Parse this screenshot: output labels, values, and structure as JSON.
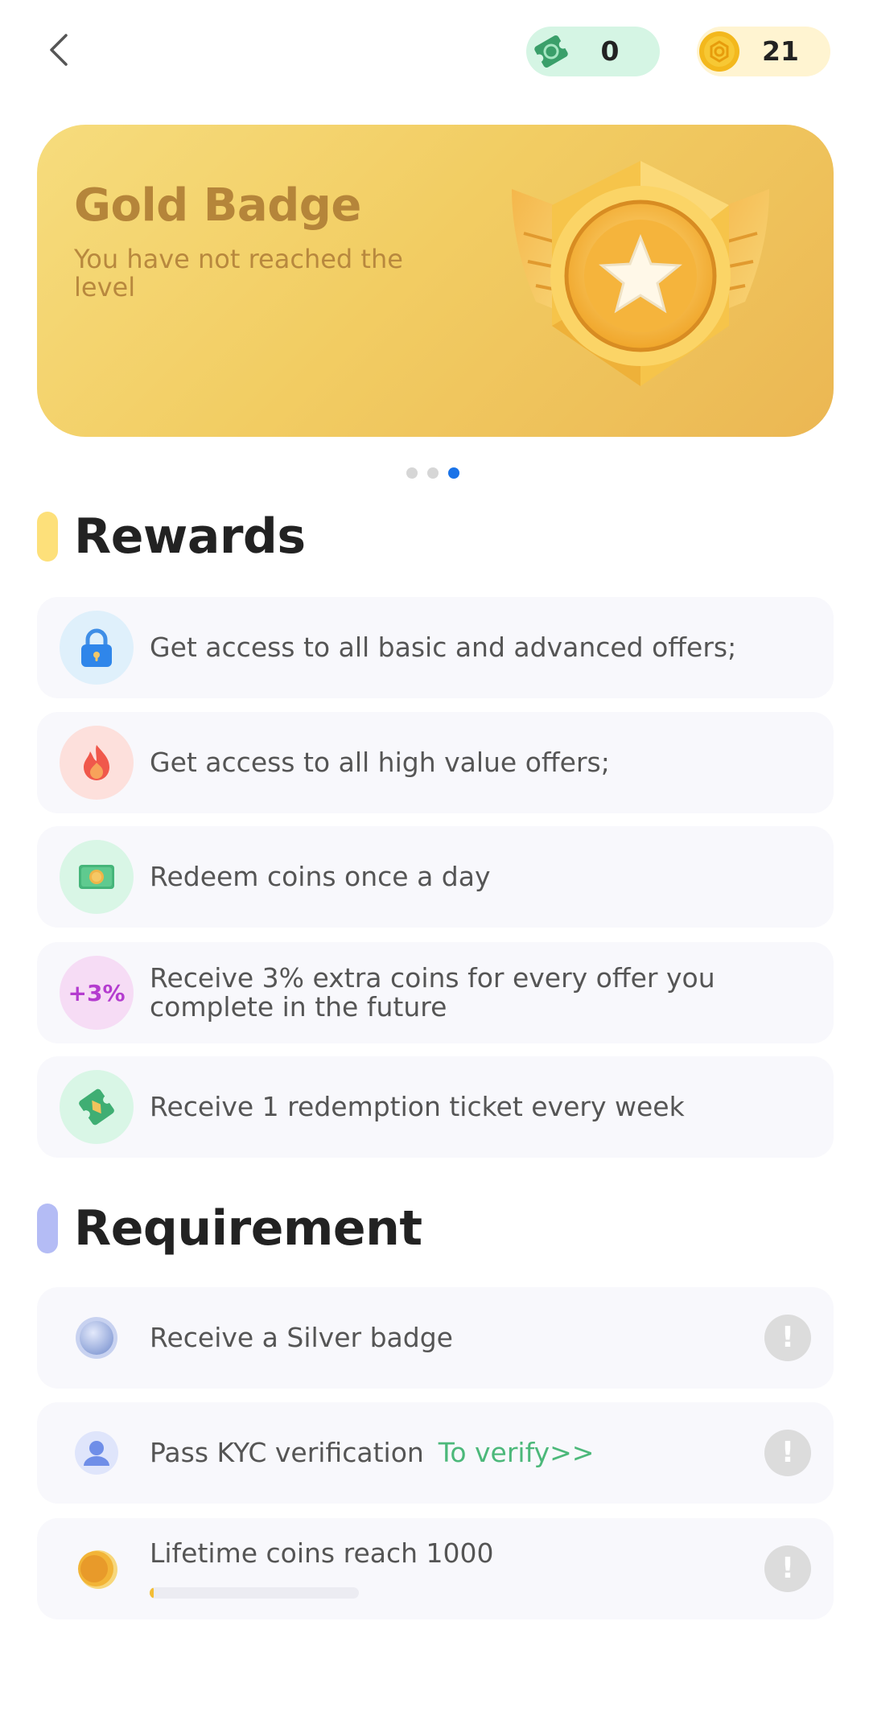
{
  "header": {
    "ticket_count": "0",
    "coin_count": "21"
  },
  "banner": {
    "title": "Gold Badge",
    "subtitle": "You have not reached the level"
  },
  "pager": {
    "count": 3,
    "active_index": 2
  },
  "rewards": {
    "title": "Rewards",
    "items": [
      {
        "icon": "lock-icon",
        "text": "Get access to all basic and advanced offers;"
      },
      {
        "icon": "fire-icon",
        "text": "Get access to all high value offers;"
      },
      {
        "icon": "coin-card-icon",
        "text": "Redeem coins once a day"
      },
      {
        "icon": "plus-percent-icon",
        "icon_text": "+3%",
        "text": "Receive 3% extra coins for every offer you complete in the future"
      },
      {
        "icon": "ticket-icon",
        "text": "Receive 1 redemption ticket every week"
      }
    ]
  },
  "requirement": {
    "title": "Requirement",
    "items": [
      {
        "icon": "silver-badge-icon",
        "text": "Receive a Silver badge"
      },
      {
        "icon": "user-icon",
        "text": "Pass KYC verification",
        "link": "To verify>>"
      },
      {
        "icon": "coin-icon",
        "text": "Lifetime coins reach 1000",
        "progress": 0.021
      }
    ],
    "warn_symbol": "!"
  },
  "colors": {
    "banner_gold": "#f2cd63",
    "rewards_bar": "#fde07a",
    "requirement_bar": "#b4bcf5",
    "link_green": "#4cb87a",
    "active_dot": "#1a73e8"
  }
}
